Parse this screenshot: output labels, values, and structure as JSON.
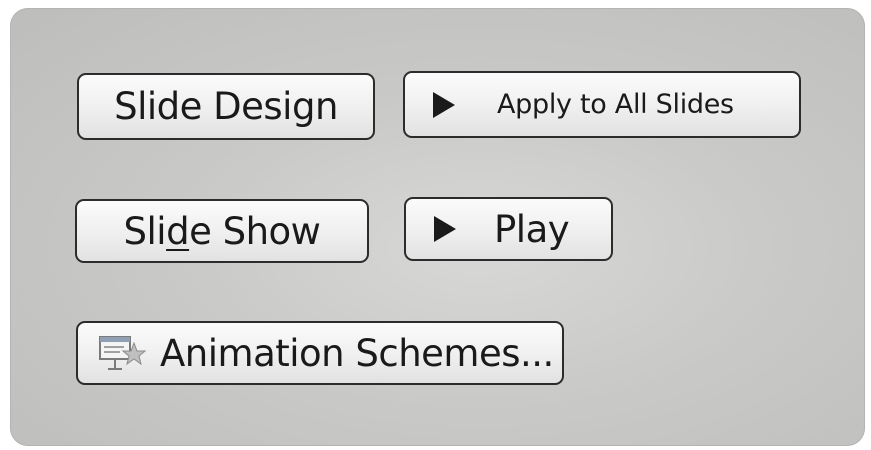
{
  "buttons": {
    "slide_design": {
      "label": "Slide Design"
    },
    "apply_to_all": {
      "label": "Apply to All Slides",
      "icon": "play-triangle-icon"
    },
    "slide_show": {
      "label_pre": "Sli",
      "label_accel": "d",
      "label_post": "e Show"
    },
    "play": {
      "label": "Play",
      "icon": "play-triangle-icon"
    },
    "animation_schemes": {
      "label": "Animation Schemes...",
      "icon": "animation-schemes-icon"
    }
  },
  "colors": {
    "panel_background": "#c9c9c7",
    "button_border": "#2c2c2c",
    "text": "#1a1a1a"
  }
}
